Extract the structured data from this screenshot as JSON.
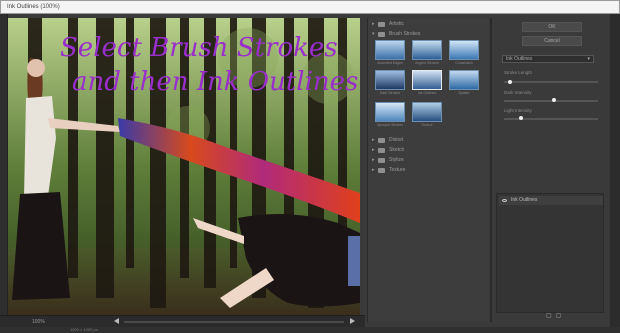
{
  "window": {
    "title": "Ink Outlines (100%)"
  },
  "canvas": {
    "handwriting_line1": "Select Brush Strokes",
    "handwriting_line2": "and then Ink Outlines"
  },
  "statusbar": {
    "zoom": "100%"
  },
  "footer": {
    "text": "1000 × 1000 px"
  },
  "filter_gallery": {
    "folders_top": [
      {
        "label": "Artistic",
        "expanded": false
      },
      {
        "label": "Brush Strokes",
        "expanded": true
      }
    ],
    "thumbnails": [
      {
        "label": "Accented Edges",
        "selected": false
      },
      {
        "label": "Angled Strokes",
        "selected": false
      },
      {
        "label": "Crosshatch",
        "selected": false
      },
      {
        "label": "Dark Strokes",
        "selected": false
      },
      {
        "label": "Ink Outlines",
        "selected": true
      },
      {
        "label": "Spatter",
        "selected": false
      },
      {
        "label": "Sprayed Strokes",
        "selected": false
      },
      {
        "label": "Sumi-e",
        "selected": false
      }
    ],
    "folders_bottom": [
      {
        "label": "Distort"
      },
      {
        "label": "Sketch"
      },
      {
        "label": "Stylize"
      },
      {
        "label": "Texture"
      }
    ]
  },
  "settings": {
    "ok_label": "OK",
    "cancel_label": "Cancel",
    "filter_select": "Ink Outlines",
    "sliders": [
      {
        "label": "Stroke Length",
        "value": 0.05
      },
      {
        "label": "Dark Intensity",
        "value": 0.5
      },
      {
        "label": "Light Intensity",
        "value": 0.15
      }
    ],
    "layer_name": "Ink Outlines"
  },
  "colors": {
    "accent_thumb_border": "#6a8fb0",
    "panel_bg": "#3d3d3d",
    "handwriting": "#9a2ecc"
  }
}
